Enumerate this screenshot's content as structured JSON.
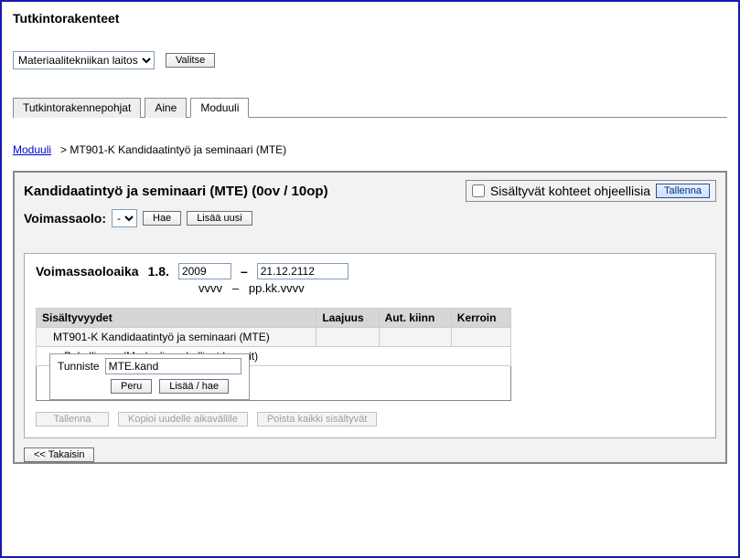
{
  "page": {
    "title": "Tutkintorakenteet"
  },
  "dept_select": {
    "value": "Materiaalitekniikan laitos"
  },
  "choose_btn": {
    "label": "Valitse"
  },
  "tabs": {
    "t1": "Tutkintorakennepohjat",
    "t2": "Aine",
    "t3": "Moduuli"
  },
  "breadcrumb": {
    "link": "Moduuli",
    "sep": ">",
    "current": "MT901-K Kandidaatintyö ja seminaari (MTE)"
  },
  "box": {
    "title": "Kandidaatintyö ja seminaari (MTE) (0ov / 10op)",
    "chk_label": "Sisältyvät kohteet ohjeellisia",
    "save": "Tallenna"
  },
  "validity": {
    "label": "Voimassaolo:",
    "select_value": "-",
    "hae": "Hae",
    "add": "Lisää uusi"
  },
  "period": {
    "label": "Voimassaoloaika",
    "from_prefix": "1.8.",
    "from_year": "2009",
    "dash": "–",
    "to": "21.12.2112",
    "hint_from": "vvvv",
    "hint_dash": "–",
    "hint_to": "pp.kk.vvvv"
  },
  "table": {
    "h1": "Sisältyvyydet",
    "h2": "Laajuus",
    "h3": "Aut. kiinn",
    "h4": "Kerroin",
    "row1": "MT901-K Kandidaatintyö ja seminaari (MTE)",
    "row2": "Pakollisuus (Moduulin pakolliset kurssit)"
  },
  "tunniste": {
    "label": "Tunniste",
    "value": "MTE.kand",
    "cancel": "Peru",
    "addfetch": "Lisää / hae"
  },
  "footer": {
    "save": "Tallenna",
    "copy": "Kopioi uudelle aikavälille",
    "delete": "Poista kaikki sisältyvät"
  },
  "back": {
    "label": "<< Takaisin"
  }
}
